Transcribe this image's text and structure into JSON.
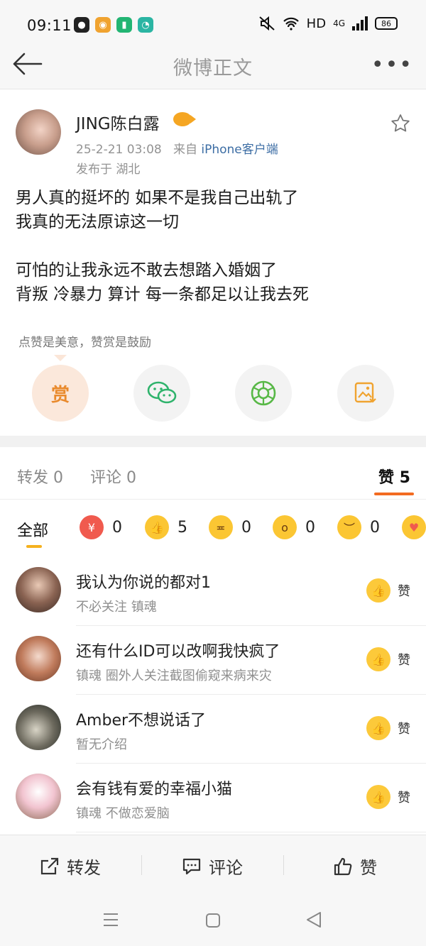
{
  "status_bar": {
    "time": "09:11",
    "network": "HD",
    "signal": "4G",
    "battery": "86"
  },
  "nav": {
    "title": "微博正文"
  },
  "post": {
    "author": "JING陈白露",
    "date": "25-2-21 03:08",
    "source_prefix": "来自",
    "source": "iPhone客户端",
    "location": "发布于 湖北",
    "lines": [
      "男人真的挺坏的 如果不是我自己出轨了",
      "我真的无法原谅这一切",
      "",
      "可怕的让我永远不敢去想踏入婚姻了",
      "背叛 冷暴力 算计 每一条都足以让我去死"
    ]
  },
  "reward": {
    "tip": "点赞是美意，赞赏是鼓励",
    "button_label": "赏"
  },
  "tabs": {
    "repost": "转发 0",
    "comment": "评论 0",
    "like": "赞 5"
  },
  "filters": {
    "all": "全部",
    "items": [
      {
        "icon": "reward-emoji-icon",
        "count": "0"
      },
      {
        "icon": "thumbs-up-emoji-icon",
        "count": "5"
      },
      {
        "icon": "laugh-emoji-icon",
        "count": "0"
      },
      {
        "icon": "surprised-emoji-icon",
        "count": "0"
      },
      {
        "icon": "sad-emoji-icon",
        "count": "0"
      },
      {
        "icon": "heart-emoji-icon",
        "count": ""
      }
    ]
  },
  "likes": [
    {
      "name": "我认为你说的都对1",
      "desc": "不必关注 镇魂",
      "button": "赞"
    },
    {
      "name": "还有什么ID可以改啊我快疯了",
      "desc": "镇魂 圈外人关注截图偷窥来病来灾",
      "button": "赞"
    },
    {
      "name": "Amber不想说话了",
      "desc": "暂无介绍",
      "button": "赞"
    },
    {
      "name": "会有钱有爱的幸福小猫",
      "desc": "镇魂 不做恋爱脑",
      "button": "赞"
    }
  ],
  "bottom_bar": {
    "repost": "转发",
    "comment": "评论",
    "like": "赞"
  },
  "colors": {
    "accent": "#f36b21",
    "link": "#3c6da4",
    "reward_bg": "#fbe8db",
    "emoji_yellow": "#fbc633"
  }
}
